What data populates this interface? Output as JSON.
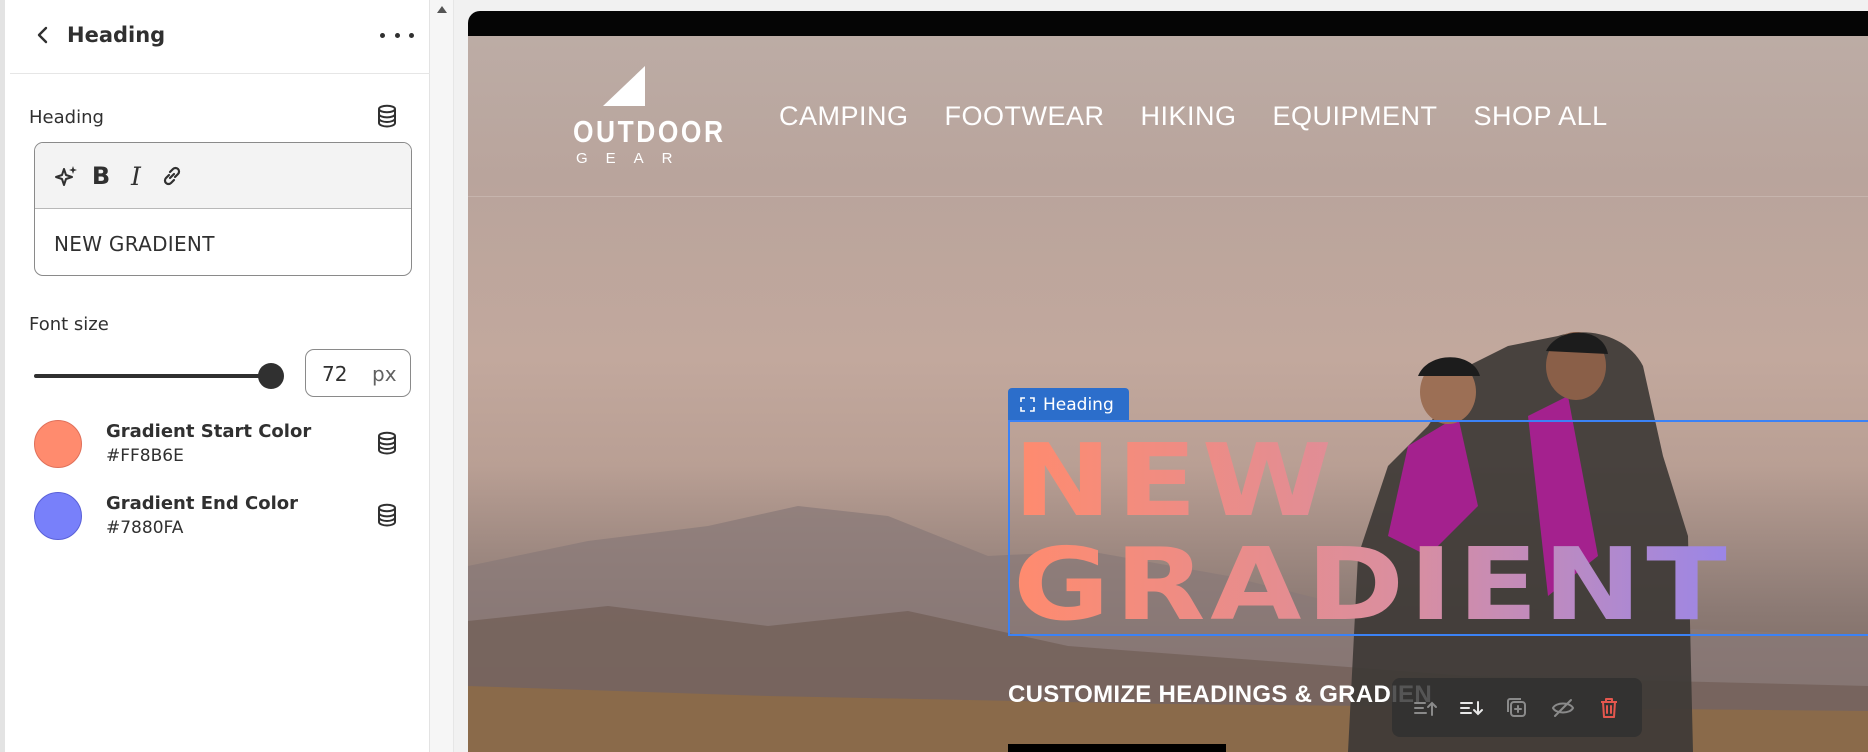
{
  "panel": {
    "title": "Heading",
    "heading_label": "Heading",
    "heading_value": "NEW GRADIENT",
    "font_size_label": "Font size",
    "font_size_value": "72",
    "font_size_unit": "px",
    "font_size_slider_fraction": 1.0,
    "gradient_start": {
      "label": "Gradient Start Color",
      "hex": "#FF8B6E"
    },
    "gradient_end": {
      "label": "Gradient End Color",
      "hex": "#7880FA"
    }
  },
  "preview": {
    "logo_word": "OUTDOOR",
    "logo_sub": "GEAR",
    "nav": [
      "CAMPING",
      "FOOTWEAR",
      "HIKING",
      "EQUIPMENT",
      "SHOP ALL"
    ],
    "selected_tag": "Heading",
    "heading_line1": "NEW",
    "heading_line2": "GRADIENT",
    "subheading": "CUSTOMIZE HEADINGS & GRADIEN"
  },
  "icons": {
    "toolbar": [
      "move-up-icon",
      "move-down-icon",
      "duplicate-icon",
      "hide-icon",
      "delete-icon"
    ]
  }
}
